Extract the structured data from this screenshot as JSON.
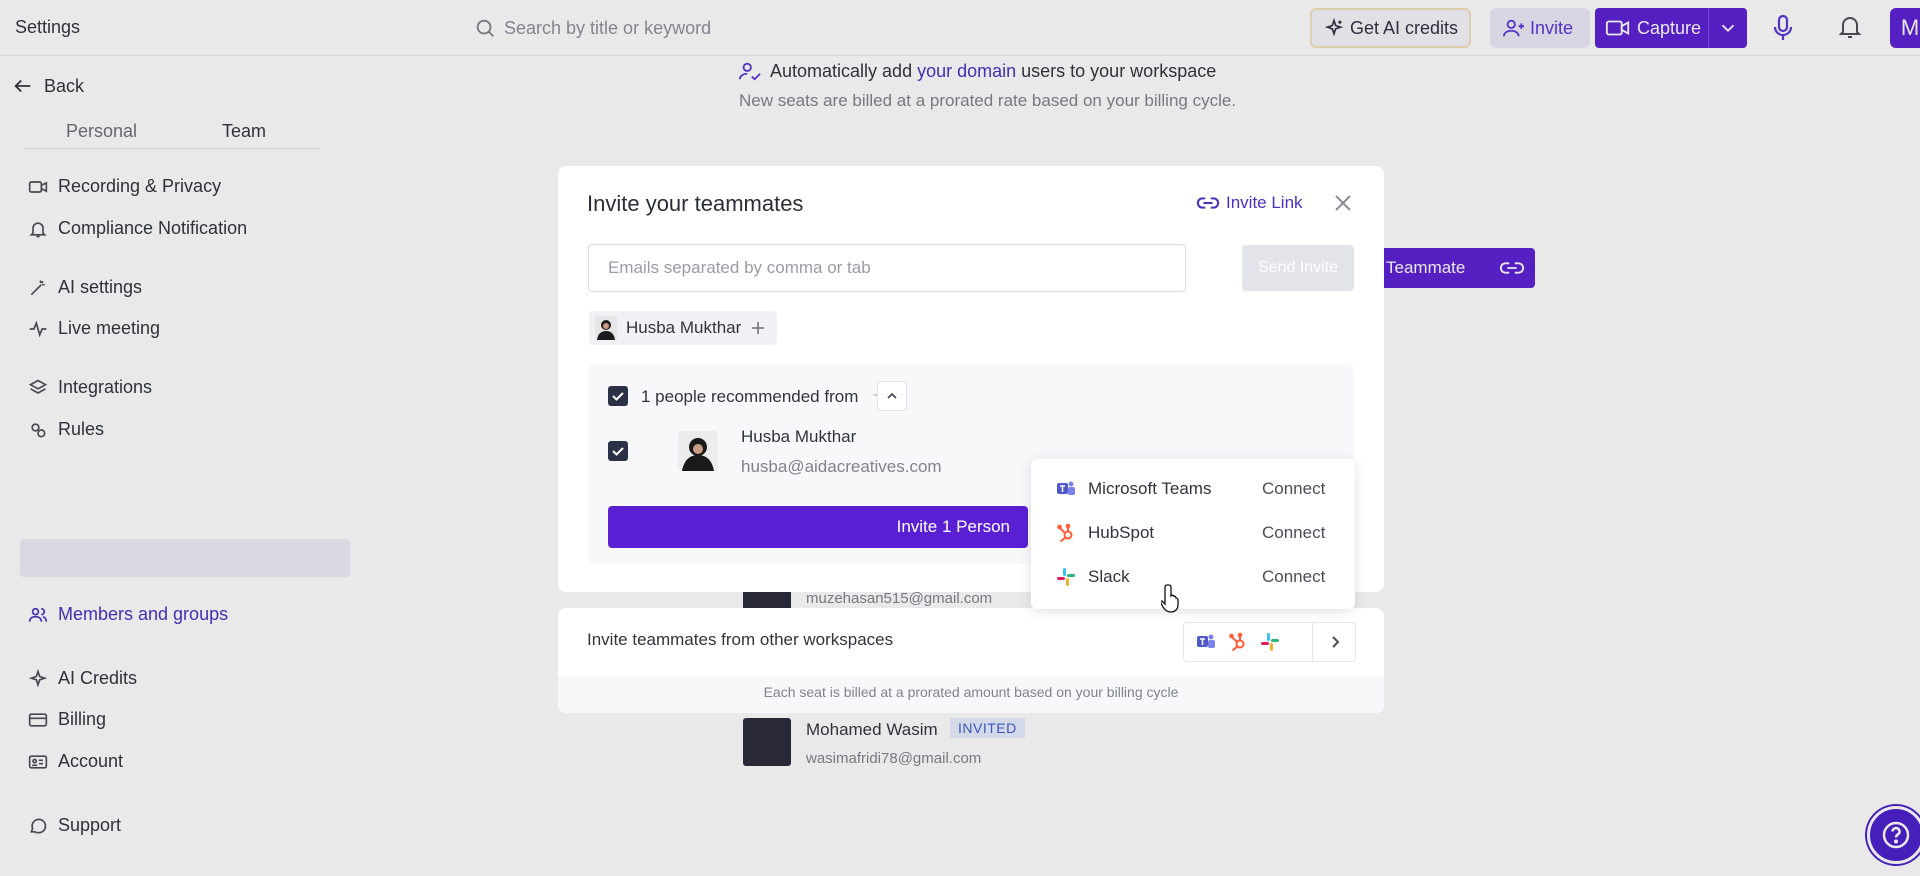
{
  "topbar": {
    "title": "Settings",
    "search_placeholder": "Search by title or keyword",
    "credits_label": "Get AI credits",
    "invite_label": "Invite",
    "capture_label": "Capture",
    "avatar_initial": "M"
  },
  "sidebar": {
    "back_label": "Back",
    "tabs": [
      "Personal",
      "Team"
    ],
    "items": [
      {
        "label": "Recording & Privacy",
        "icon": "video-icon"
      },
      {
        "label": "Compliance Notification",
        "icon": "bell-icon"
      },
      {
        "label": "AI settings",
        "icon": "magic-wand-icon"
      },
      {
        "label": "Live meeting",
        "icon": "pulse-icon"
      },
      {
        "label": "Integrations",
        "icon": "layers-icon"
      },
      {
        "label": "Rules",
        "icon": "gears-icon"
      },
      {
        "label": "Members and groups",
        "icon": "users-icon",
        "active": true
      },
      {
        "label": "AI Credits",
        "icon": "sparkle-icon"
      },
      {
        "label": "Billing",
        "icon": "card-icon"
      },
      {
        "label": "Account",
        "icon": "id-card-icon"
      },
      {
        "label": "Support",
        "icon": "chat-bubble-icon"
      }
    ]
  },
  "background": {
    "auto_prefix": "Automatically add",
    "auto_link": "your domain",
    "auto_suffix": "users to your workspace",
    "auto_sub": "New seats are billed at a prorated rate based on your billing cycle.",
    "teammate_btn": "Teammate",
    "rows": [
      {
        "email": "muzehasan515@gmail.com"
      },
      {
        "name": "Mohamed Wasim",
        "badge": "INVITED",
        "email": "wasimafridi78@gmail.com"
      }
    ]
  },
  "modal": {
    "title": "Invite your teammates",
    "invite_link_label": "Invite Link",
    "email_placeholder": "Emails separated by comma or tab",
    "send_label": "Send Invite",
    "chip_name": "Husba Mukthar",
    "rec_count": "1 people",
    "rec_text": "recommended from",
    "person": {
      "name": "Husba Mukthar",
      "email": "husba@aidacreatives.com"
    },
    "invite_person_label": "Invite 1 Person"
  },
  "dropdown": {
    "items": [
      {
        "name": "Microsoft Teams",
        "action": "Connect",
        "icon": "teams-icon"
      },
      {
        "name": "HubSpot",
        "action": "Connect",
        "icon": "hubspot-icon"
      },
      {
        "name": "Slack",
        "action": "Connect",
        "icon": "slack-icon"
      }
    ]
  },
  "other": {
    "title": "Invite teammates from other workspaces",
    "note": "Each seat is billed at a prorated amount based on your billing cycle"
  },
  "colors": {
    "brand": "#5b1fd3",
    "accent_text": "#4a2fc0"
  }
}
